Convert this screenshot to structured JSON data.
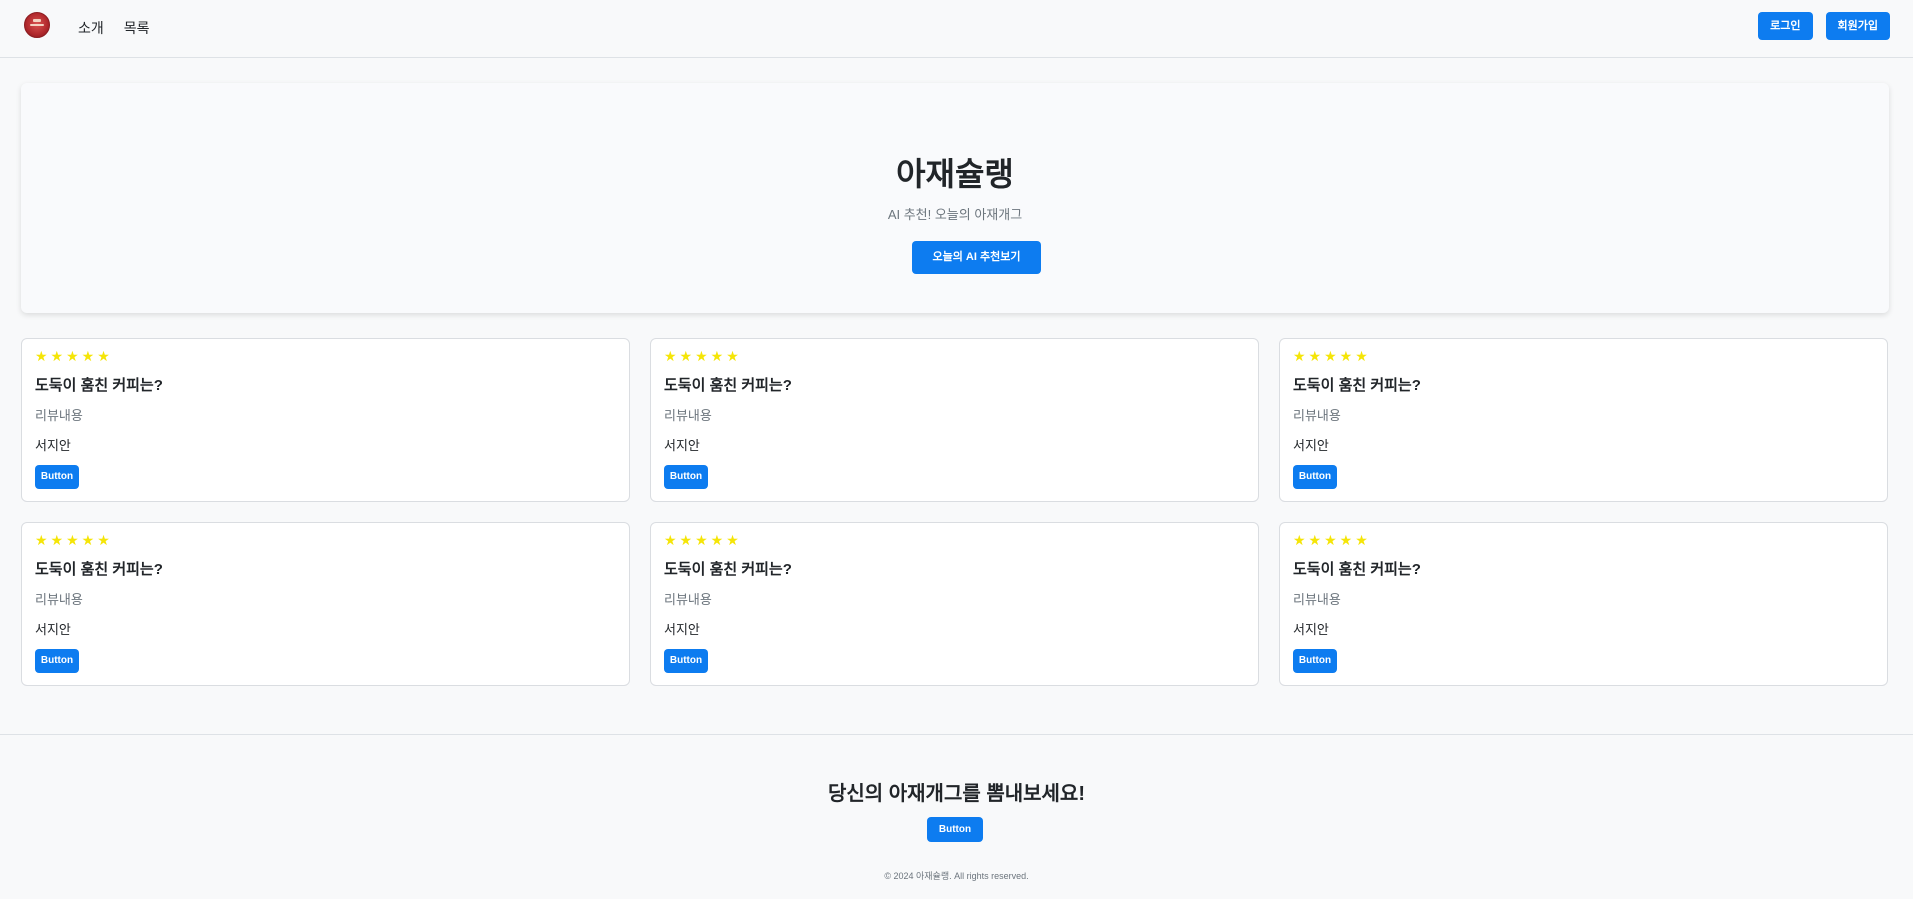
{
  "nav": {
    "links": [
      "소개",
      "목록"
    ],
    "login_label": "로그인",
    "signup_label": "회원가입"
  },
  "hero": {
    "title": "아재슐랭",
    "subtitle": "AI 추천! 오늘의 아재개그",
    "button_label": "오늘의 AI 추천보기"
  },
  "cards": [
    {
      "rating": 5,
      "stars": "★★★★★",
      "title": "도둑이 훔친 커피는?",
      "text": "리뷰내용",
      "author": "서지안",
      "button_label": "Button"
    },
    {
      "rating": 5,
      "stars": "★★★★★",
      "title": "도둑이 훔친 커피는?",
      "text": "리뷰내용",
      "author": "서지안",
      "button_label": "Button"
    },
    {
      "rating": 5,
      "stars": "★★★★★",
      "title": "도둑이 훔친 커피는?",
      "text": "리뷰내용",
      "author": "서지안",
      "button_label": "Button"
    },
    {
      "rating": 5,
      "stars": "★★★★★",
      "title": "도둑이 훔친 커피는?",
      "text": "리뷰내용",
      "author": "서지안",
      "button_label": "Button"
    },
    {
      "rating": 5,
      "stars": "★★★★★",
      "title": "도둑이 훔친 커피는?",
      "text": "리뷰내용",
      "author": "서지안",
      "button_label": "Button"
    },
    {
      "rating": 5,
      "stars": "★★★★★",
      "title": "도둑이 훔친 커피는?",
      "text": "리뷰내용",
      "author": "서지안",
      "button_label": "Button"
    }
  ],
  "footer": {
    "title": "당신의 아재개그를 뽐내보세요!",
    "button_label": "Button",
    "copyright": "© 2024 아재슐랭. All rights reserved."
  },
  "colors": {
    "primary": "#0d7cf0",
    "star": "#f5e507",
    "background": "#f8f9fa"
  },
  "icons": {
    "logo": "restaurant-logo-icon",
    "rating": "star-icon"
  }
}
